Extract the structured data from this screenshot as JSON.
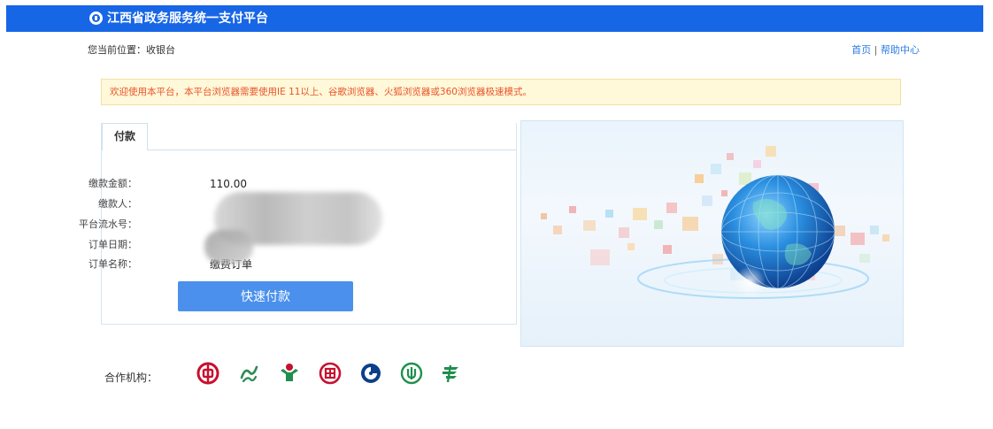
{
  "header": {
    "title": "江西省政务服务统一支付平台",
    "logo_icon": "platform-logo-icon",
    "background_color": "#1766e6"
  },
  "breadcrumb": {
    "text": "您当前位置：收银台"
  },
  "top_links": {
    "home": "首页",
    "separator": " | ",
    "help": "帮助中心"
  },
  "notice": {
    "text": "欢迎使用本平台，本平台浏览器需要使用IE 11以上、谷歌浏览器、火狐浏览器或360浏览器极速模式。",
    "color": "#e8542a"
  },
  "payment": {
    "tab_label": "付款",
    "fields": [
      {
        "label": "缴款金额：",
        "value": "110.00"
      },
      {
        "label": "缴款人：",
        "value": ""
      },
      {
        "label": "平台流水号：",
        "value": ""
      },
      {
        "label": "订单日期：",
        "value": ""
      },
      {
        "label": "订单名称：",
        "value": "缴费订单"
      }
    ],
    "button_label": "快速付款",
    "button_color": "#4a90ec"
  },
  "partners": {
    "label": "合作机构：",
    "banks": [
      {
        "icon": "bank-of-china-icon",
        "color": "#c8102e"
      },
      {
        "icon": "bank-of-communications-icon",
        "color": "#2e8b57"
      },
      {
        "icon": "agricultural-bank-icon",
        "color": "#1f8f4e"
      },
      {
        "icon": "industrial-commercial-bank-icon",
        "color": "#c8102e"
      },
      {
        "icon": "construction-bank-icon",
        "color": "#0b3f8a"
      },
      {
        "icon": "china-post-icon",
        "color": "#1f8f4e"
      },
      {
        "icon": "postal-savings-icon",
        "color": "#1f8f4e"
      }
    ]
  }
}
